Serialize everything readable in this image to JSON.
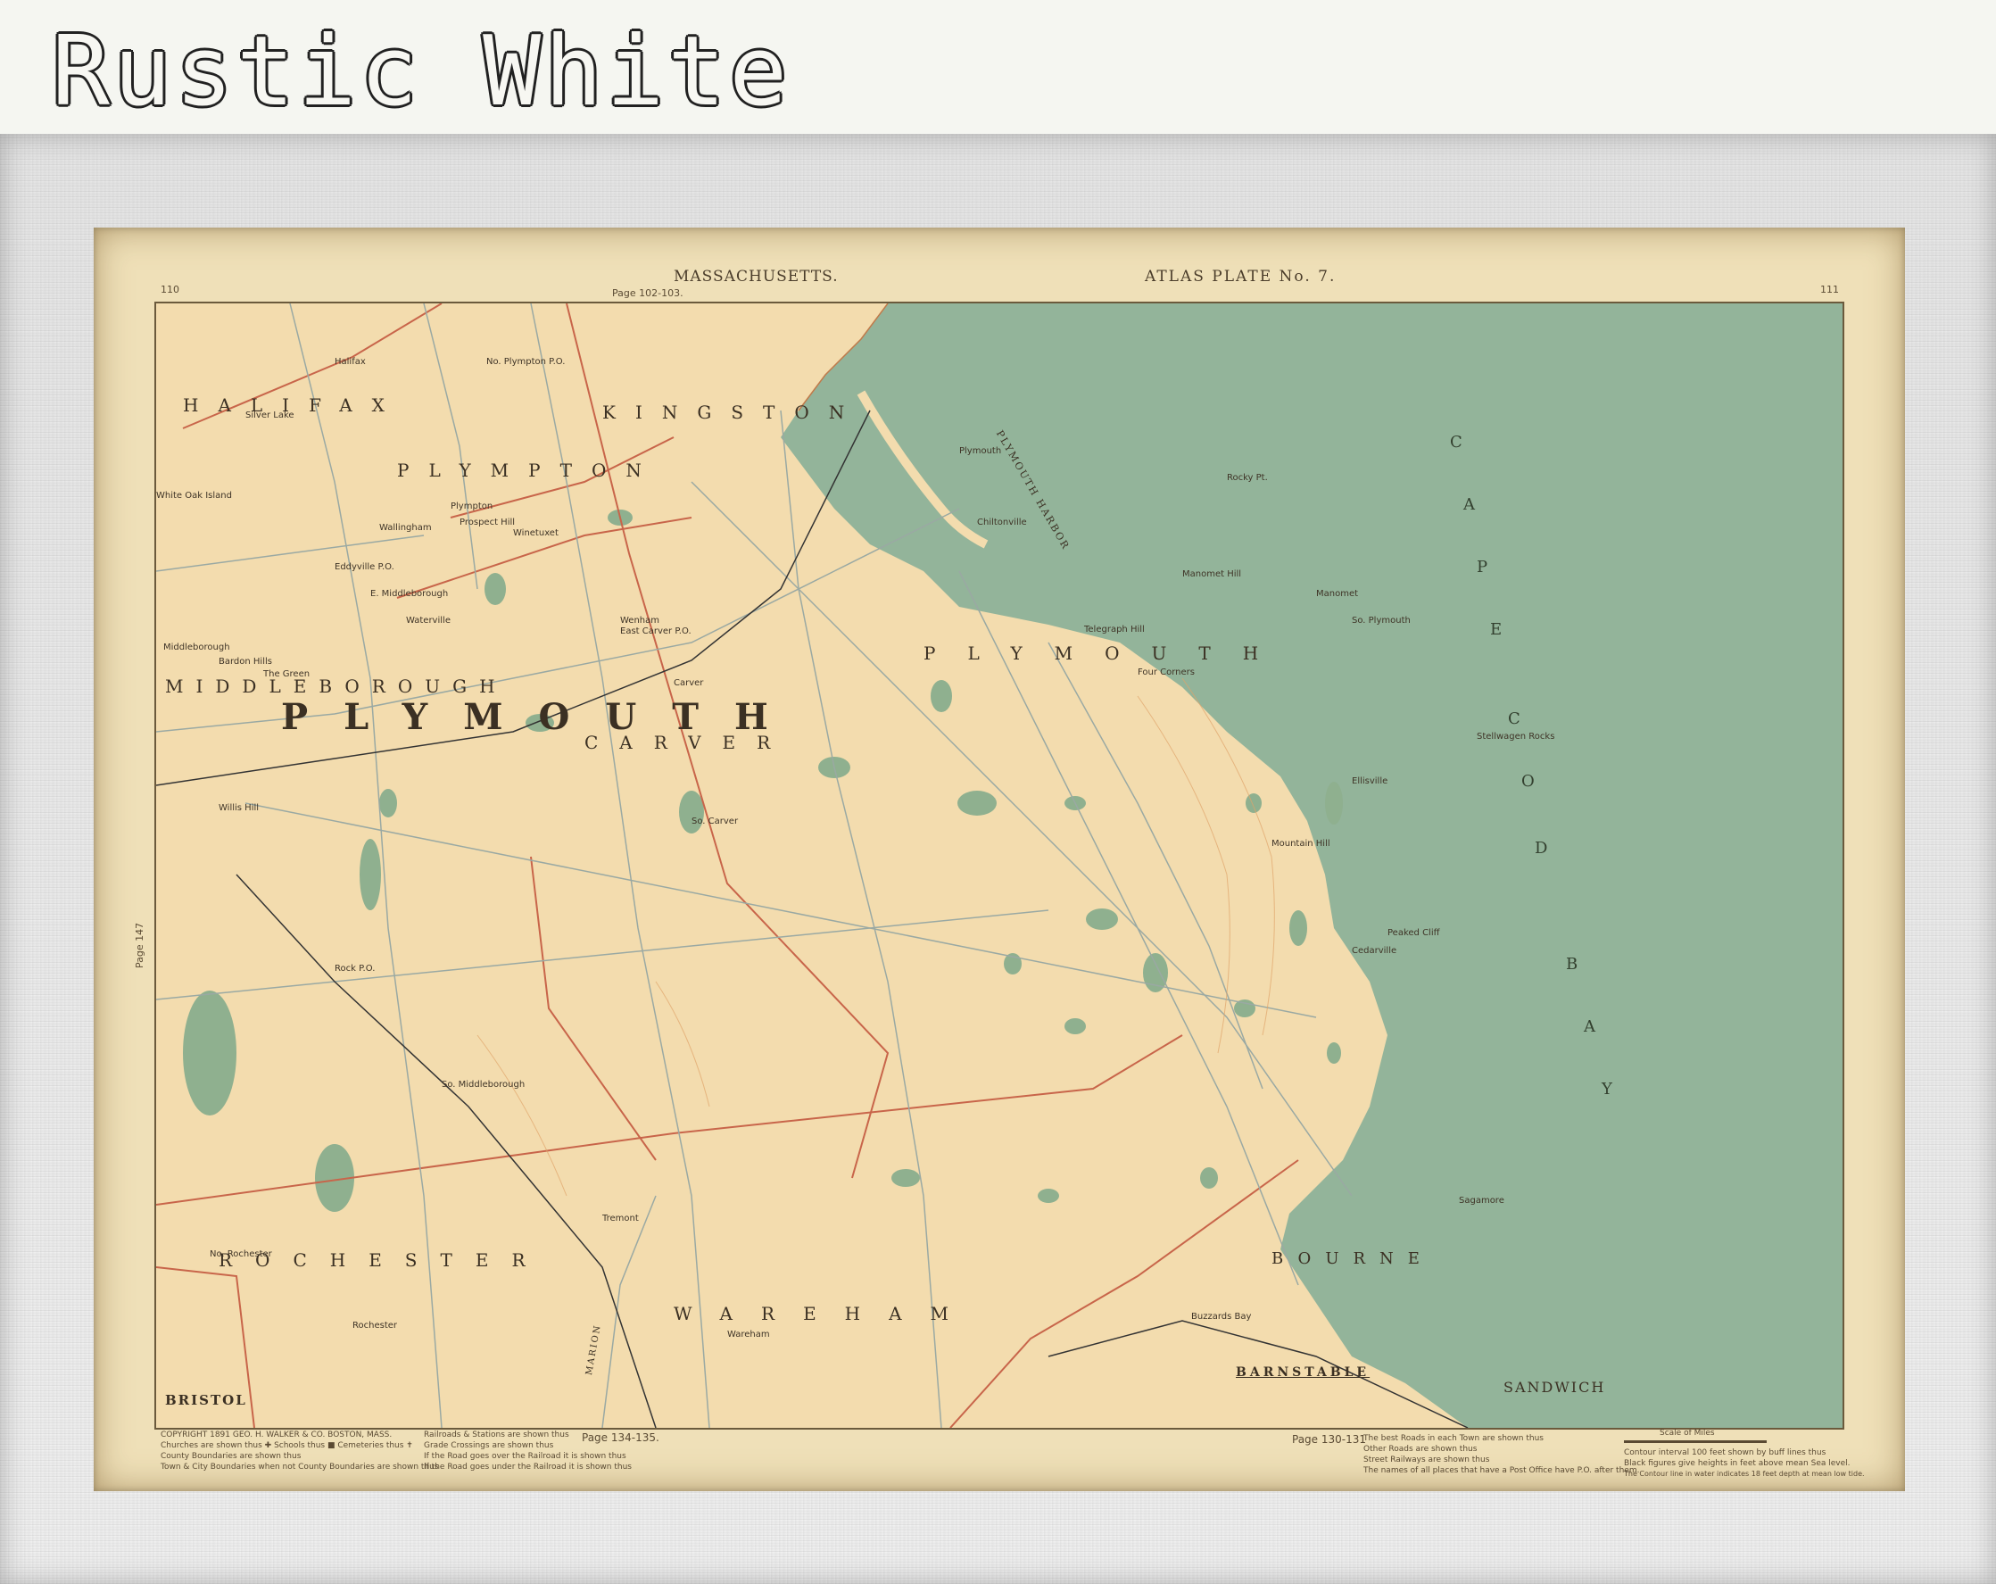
{
  "banner": {
    "title": "Rustic White"
  },
  "map": {
    "header": {
      "state": "MASSACHUSETTS.",
      "plate": "ATLAS PLATE No. 7.",
      "page_left": "110",
      "page_right": "111",
      "page_ref_top": "Page 102-103.",
      "page_ref_left": "Page 147",
      "page_ref_bottom_left": "Page 134-135.",
      "page_ref_bottom_right": "Page 130-131"
    },
    "regions": {
      "halifax": "HALIFAX",
      "kingston": "KINGSTON",
      "plympton": "PLYMPTON",
      "middleborough": "MIDDLEBOROUGH",
      "plymouth_county": "PLYMOUTH",
      "plymouth_town": "PLYMOUTH",
      "carver": "CARVER",
      "rochester": "ROCHESTER",
      "wareham": "WAREHAM",
      "bourne": "BOURNE",
      "barnstable": "BARNSTABLE",
      "sandwich": "SANDWICH",
      "bristol": "BRISTOL",
      "marion": "MARION",
      "cape_cod_bay": [
        "C",
        "A",
        "P",
        "E",
        "C",
        "O",
        "D",
        "B",
        "A",
        "Y"
      ],
      "plymouth_harbor": "PLYMOUTH HARBOR"
    },
    "places": [
      "Plympton",
      "Winetuxet",
      "Wallingham",
      "Prospect Hill",
      "Eddyville P.O.",
      "E. Middleborough",
      "Waterville",
      "Middleborough",
      "Bardon Hills",
      "Wenham",
      "East Carver P.O.",
      "Carver",
      "So. Carver",
      "Manomet Hill",
      "Telegraph Hill",
      "Four Corners",
      "Manomet",
      "So. Plymouth",
      "Ellisville",
      "Mountain Hill",
      "Cedarville",
      "Peaked Cliff",
      "Sagamore",
      "Rocky Pt.",
      "Chiltonville",
      "Plymouth",
      "No. Plympton P.O.",
      "Halifax",
      "Silver Lake",
      "The Green",
      "So. Middleborough",
      "No. Rochester",
      "Rochester",
      "Wareham",
      "Tremont",
      "Buzzards Bay",
      "Stellwagen Rocks",
      "White Oak Island",
      "Willis Hill",
      "Rock P.O."
    ],
    "footer": {
      "copyright": "COPYRIGHT 1891 GEO. H. WALKER & CO. BOSTON, MASS.",
      "legend_left": [
        "Churches are shown thus ✚ Schools thus ■ Cemeteries thus ✝",
        "County Boundaries are shown thus",
        "Town & City Boundaries when not County Boundaries are shown thus"
      ],
      "legend_mid": [
        "Railroads & Stations are shown thus",
        "Grade Crossings are shown thus",
        "If the Road goes over the Railroad it is shown thus",
        "If the Road goes under the Railroad it is shown thus"
      ],
      "legend_right": [
        "The best Roads in each Town are shown thus",
        "Other Roads are shown thus",
        "Street Railways are shown thus",
        "The names of all places that have a Post Office have P.O. after them."
      ],
      "legend_far_right": [
        "Contour interval 100 feet shown by buff lines thus",
        "Black figures give heights in feet above mean Sea level.",
        "The Contour line in water indicates 18 feet depth at mean low tide."
      ],
      "scale": "Scale of Miles"
    }
  }
}
